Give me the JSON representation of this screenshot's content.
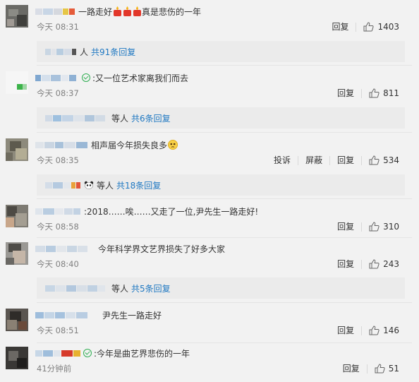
{
  "comments": [
    {
      "text": "一路走好",
      "text_tail": "真是悲伤的一年",
      "time": "今天 08:31",
      "actions": [
        "回复"
      ],
      "likes": "1403",
      "replies": {
        "suffix": "人",
        "link": "共91条回复"
      }
    },
    {
      "text": ":又一位艺术家离我们而去",
      "time": "今天 08:37",
      "actions": [
        "回复"
      ],
      "likes": "811",
      "replies": {
        "suffix": "等人",
        "link": "共6条回复"
      }
    },
    {
      "text": "相声届今年损失良多",
      "time": "今天 08:35",
      "actions": [
        "投诉",
        "屏蔽",
        "回复"
      ],
      "likes": "534",
      "replies": {
        "suffix": "等人",
        "link": "共18条回复"
      }
    },
    {
      "text": ":2018……唉……又走了一位,尹先生一路走好!",
      "time": "今天 08:58",
      "actions": [
        "回复"
      ],
      "likes": "310"
    },
    {
      "text": "今年科学界文艺界损失了好多大家",
      "time": "今天 08:40",
      "actions": [
        "回复"
      ],
      "likes": "243",
      "replies": {
        "suffix": "等人",
        "link": "共5条回复"
      }
    },
    {
      "text": "尹先生一路走好",
      "time": "今天 08:51",
      "actions": [
        "回复"
      ],
      "likes": "146"
    },
    {
      "text": ":今年是曲艺界悲伤的一年",
      "time": "41分钟前",
      "actions": [
        "回复"
      ],
      "likes": "51"
    }
  ],
  "colors": {
    "link": "#1f78c2",
    "muted": "#808080",
    "background": "#f2f2f2",
    "reply_box": "#ebebeb"
  }
}
